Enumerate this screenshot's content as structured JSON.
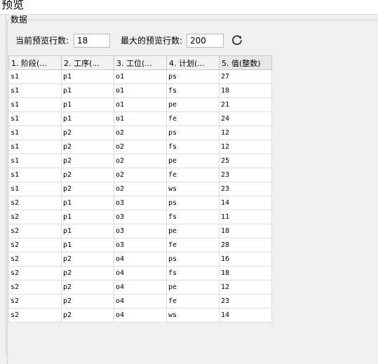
{
  "window": {
    "title": "预览"
  },
  "group": {
    "title": "数据"
  },
  "controls": {
    "current_rows_label": "当前预览行数:",
    "current_rows_value": "18",
    "max_rows_label": "最大的预览行数:",
    "max_rows_value": "200",
    "refresh_icon": "refresh-icon"
  },
  "table": {
    "columns": [
      "1. 阶段(...",
      "2. 工序(...",
      "3. 工位(...",
      "4. 计划(...",
      "5. 值(整数)"
    ],
    "rows": [
      [
        "s1",
        "p1",
        "o1",
        "ps",
        "27"
      ],
      [
        "s1",
        "p1",
        "o1",
        "fs",
        "18"
      ],
      [
        "s1",
        "p1",
        "o1",
        "pe",
        "21"
      ],
      [
        "s1",
        "p1",
        "o1",
        "fe",
        "24"
      ],
      [
        "s1",
        "p2",
        "o2",
        "ps",
        "12"
      ],
      [
        "s1",
        "p2",
        "o2",
        "fs",
        "12"
      ],
      [
        "s1",
        "p2",
        "o2",
        "pe",
        "25"
      ],
      [
        "s1",
        "p2",
        "o2",
        "fe",
        "23"
      ],
      [
        "s1",
        "p2",
        "o2",
        "ws",
        "23"
      ],
      [
        "s2",
        "p1",
        "o3",
        "ps",
        "14"
      ],
      [
        "s2",
        "p1",
        "o3",
        "fs",
        "11"
      ],
      [
        "s2",
        "p1",
        "o3",
        "pe",
        "18"
      ],
      [
        "s2",
        "p1",
        "o3",
        "fe",
        "28"
      ],
      [
        "s2",
        "p2",
        "o4",
        "ps",
        "16"
      ],
      [
        "s2",
        "p2",
        "o4",
        "fs",
        "18"
      ],
      [
        "s2",
        "p2",
        "o4",
        "pe",
        "12"
      ],
      [
        "s2",
        "p2",
        "o4",
        "fe",
        "23"
      ],
      [
        "s2",
        "p2",
        "o4",
        "ws",
        "14"
      ]
    ]
  }
}
